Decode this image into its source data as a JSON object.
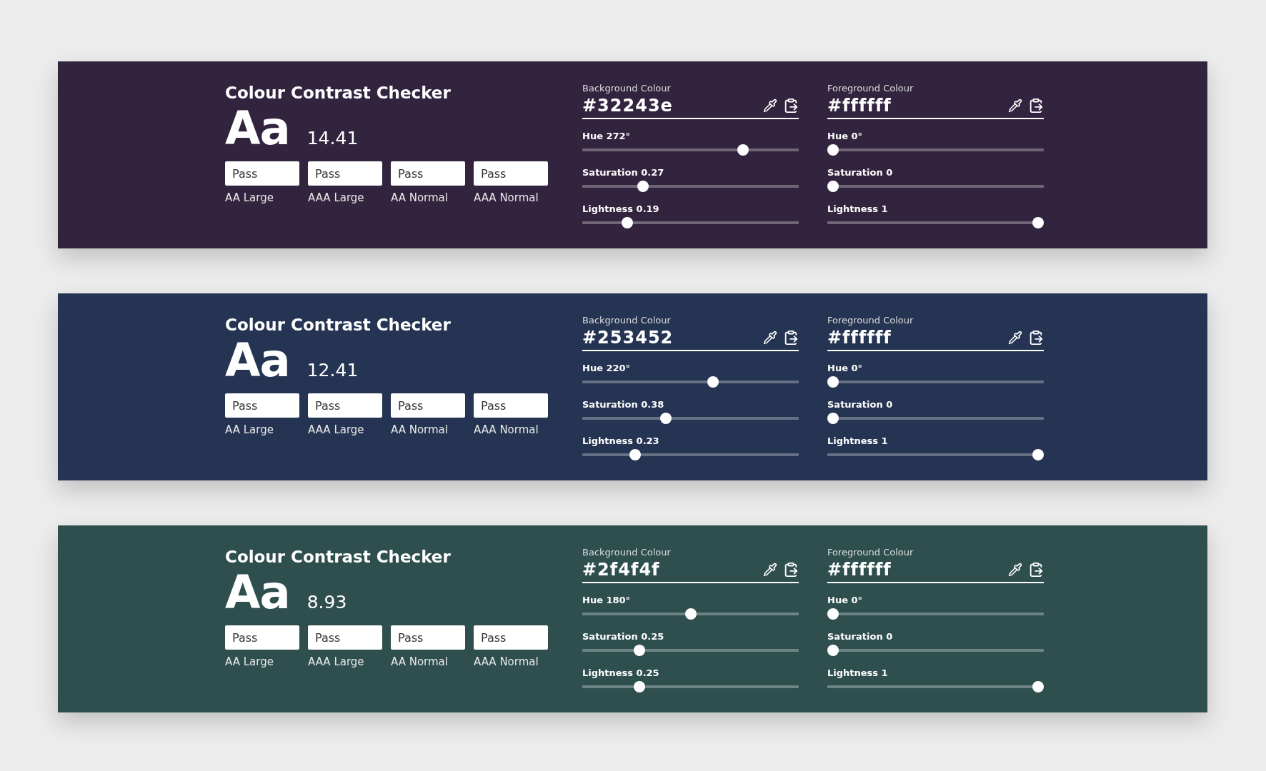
{
  "panels": [
    {
      "title": "Colour Contrast Checker",
      "sample": "Aa",
      "ratio": "14.41",
      "results": [
        {
          "status": "Pass",
          "label": "AA Large"
        },
        {
          "status": "Pass",
          "label": "AAA Large"
        },
        {
          "status": "Pass",
          "label": "AA Normal"
        },
        {
          "status": "Pass",
          "label": "AAA Normal"
        }
      ],
      "colours": [
        {
          "label": "Background Colour",
          "value": "#32243e",
          "sliders": [
            {
              "label": "Hue 272°",
              "level": 0.756
            },
            {
              "label": "Saturation 0.27",
              "level": 0.27
            },
            {
              "label": "Lightness 0.19",
              "level": 0.19
            }
          ]
        },
        {
          "label": "Foreground Colour",
          "value": "#ffffff",
          "sliders": [
            {
              "label": "Hue 0°",
              "level": 0
            },
            {
              "label": "Saturation 0",
              "level": 0
            },
            {
              "label": "Lightness 1",
              "level": 1
            }
          ]
        }
      ]
    },
    {
      "title": "Colour Contrast Checker",
      "sample": "Aa",
      "ratio": "12.41",
      "results": [
        {
          "status": "Pass",
          "label": "AA Large"
        },
        {
          "status": "Pass",
          "label": "AAA Large"
        },
        {
          "status": "Pass",
          "label": "AA Normal"
        },
        {
          "status": "Pass",
          "label": "AAA Normal"
        }
      ],
      "colours": [
        {
          "label": "Background Colour",
          "value": "#253452",
          "sliders": [
            {
              "label": "Hue 220°",
              "level": 0.611
            },
            {
              "label": "Saturation 0.38",
              "level": 0.38
            },
            {
              "label": "Lightness 0.23",
              "level": 0.23
            }
          ]
        },
        {
          "label": "Foreground Colour",
          "value": "#ffffff",
          "sliders": [
            {
              "label": "Hue 0°",
              "level": 0
            },
            {
              "label": "Saturation 0",
              "level": 0
            },
            {
              "label": "Lightness 1",
              "level": 1
            }
          ]
        }
      ]
    },
    {
      "title": "Colour Contrast Checker",
      "sample": "Aa",
      "ratio": "8.93",
      "results": [
        {
          "status": "Pass",
          "label": "AA Large"
        },
        {
          "status": "Pass",
          "label": "AAA Large"
        },
        {
          "status": "Pass",
          "label": "AA Normal"
        },
        {
          "status": "Pass",
          "label": "AAA Normal"
        }
      ],
      "colours": [
        {
          "label": "Background Colour",
          "value": "#2f4f4f",
          "sliders": [
            {
              "label": "Hue 180°",
              "level": 0.5
            },
            {
              "label": "Saturation 0.25",
              "level": 0.25
            },
            {
              "label": "Lightness 0.25",
              "level": 0.25
            }
          ]
        },
        {
          "label": "Foreground Colour",
          "value": "#ffffff",
          "sliders": [
            {
              "label": "Hue 0°",
              "level": 0
            },
            {
              "label": "Saturation 0",
              "level": 0
            },
            {
              "label": "Lightness 1",
              "level": 1
            }
          ]
        }
      ]
    }
  ]
}
